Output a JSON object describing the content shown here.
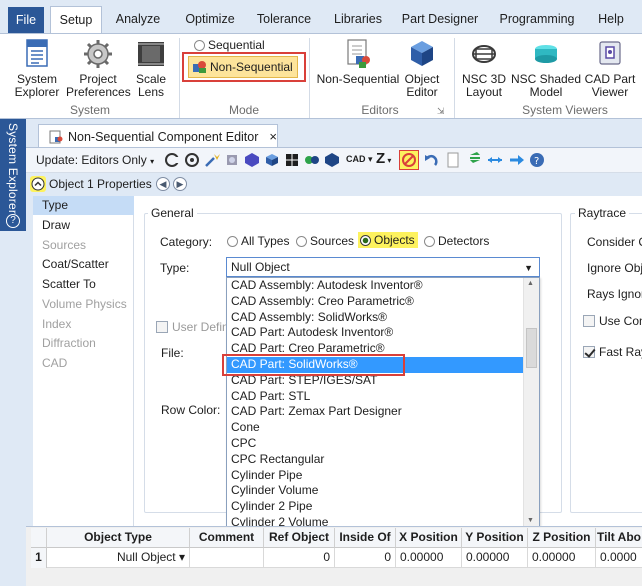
{
  "menu": {
    "tabs": [
      "File",
      "Setup",
      "Analyze",
      "Optimize",
      "Tolerance",
      "Libraries",
      "Part Designer",
      "Programming",
      "Help"
    ]
  },
  "ribbon": {
    "system": {
      "explorer": [
        "System",
        "Explorer"
      ],
      "preferences": [
        "Project",
        "Preferences"
      ],
      "scale_lens": [
        "Scale",
        "Lens"
      ],
      "group_label": "System"
    },
    "mode": {
      "sequential": "Sequential",
      "non_sequential": "Non-Sequential",
      "group_label": "Mode"
    },
    "editors": {
      "non_sequential": "Non-Sequential",
      "object_editor": [
        "Object",
        "Editor"
      ],
      "group_label": "Editors"
    },
    "viewers": {
      "nsc_3d": [
        "NSC 3D",
        "Layout"
      ],
      "nsc_shaded": [
        "NSC Shaded",
        "Model"
      ],
      "cad_part": [
        "CAD Part",
        "Viewer"
      ],
      "group_label": "System Viewers"
    }
  },
  "side_strip": {
    "label": "System Explorer",
    "help": "?"
  },
  "editor_tab": {
    "title": "Non-Sequential Component Editor",
    "close": "×"
  },
  "toolbar": {
    "update_label": "Update: Editors Only",
    "cad_label": "CAD",
    "z_label": "Z"
  },
  "properties": {
    "title": "Object 1 Properties",
    "list": [
      {
        "label": "Type",
        "state": "selected"
      },
      {
        "label": "Draw",
        "state": "normal"
      },
      {
        "label": "Sources",
        "state": "disabled"
      },
      {
        "label": "Coat/Scatter",
        "state": "normal"
      },
      {
        "label": "Scatter To",
        "state": "normal"
      },
      {
        "label": "Volume Physics",
        "state": "disabled"
      },
      {
        "label": "Index",
        "state": "disabled"
      },
      {
        "label": "Diffraction",
        "state": "disabled"
      },
      {
        "label": "CAD",
        "state": "disabled"
      }
    ],
    "general": {
      "legend": "General",
      "category_label": "Category:",
      "categories": [
        "All Types",
        "Sources",
        "Objects",
        "Detectors"
      ],
      "selected_category": "Objects",
      "type_label": "Type:",
      "type_value": "Null Object",
      "user_defined": "User Defin",
      "file_label": "File:",
      "row_color_label": "Row Color:"
    },
    "raytrace": {
      "legend": "Raytrace",
      "consider": "Consider C",
      "ignore_obj": "Ignore Obj",
      "rays_ignore": "Rays Ignor",
      "use_con": "Use Con",
      "fast_ray": "Fast Ray"
    },
    "dropdown_items": [
      "CAD Assembly: Autodesk Inventor®",
      "CAD Assembly: Creo Parametric®",
      "CAD Assembly: SolidWorks®",
      "CAD Part: Autodesk Inventor®",
      "CAD Part: Creo Parametric®",
      "CAD Part: SolidWorks®",
      "CAD Part: STEP/IGES/SAT",
      "CAD Part: STL",
      "CAD Part: Zemax Part Designer",
      "Cone",
      "CPC",
      "CPC Rectangular",
      "Cylinder Pipe",
      "Cylinder Volume",
      "Cylinder 2 Pipe",
      "Cylinder 2 Volume"
    ],
    "dropdown_selected": 5
  },
  "grid": {
    "headers": [
      "Object Type",
      "Comment",
      "Ref Object",
      "Inside Of",
      "X Position",
      "Y Position",
      "Z Position",
      "Tilt Abo"
    ],
    "row": {
      "num": "1",
      "object_type": "Null Object ▾",
      "comment": "",
      "ref_object": "0",
      "inside_of": "0",
      "x": "0.00000",
      "y": "0.00000",
      "z": "0.00000",
      "tilt": "0.0000"
    }
  },
  "colors": {
    "accent": "#2b5797",
    "highlight": "#fdf25e",
    "callout": "#d9403a",
    "selection": "#3399ff"
  }
}
